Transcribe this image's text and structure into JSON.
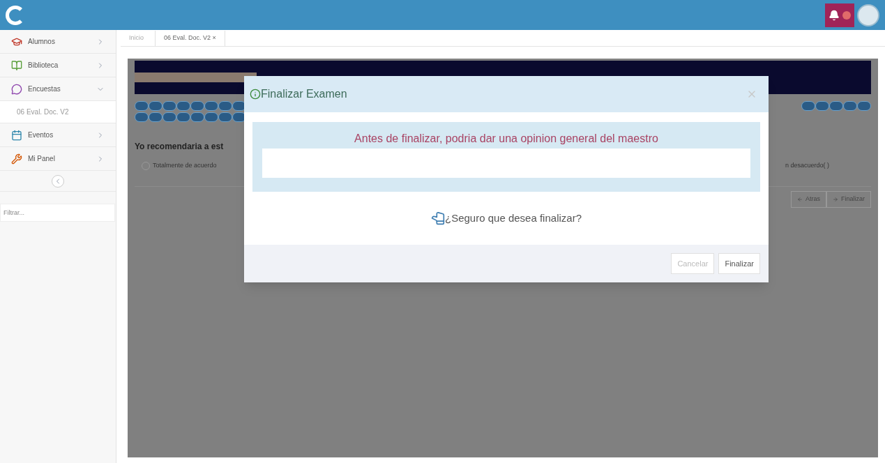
{
  "sidebar": {
    "items": [
      {
        "label": "Alumnos",
        "expanded": false
      },
      {
        "label": "Biblioteca",
        "expanded": false
      },
      {
        "label": "Encuestas",
        "expanded": true,
        "children": [
          {
            "label": "06 Eval. Doc. V2"
          }
        ]
      },
      {
        "label": "Eventos",
        "expanded": false
      },
      {
        "label": "Mi Panel",
        "expanded": false
      }
    ],
    "filter": {
      "placeholder": "Filtrar..."
    }
  },
  "tabs": [
    {
      "label": "Inicio",
      "selected": false
    },
    {
      "label": "06 Eval. Doc. V2 ×",
      "selected": true
    }
  ],
  "survey": {
    "question": "Yo recomendaria a est",
    "option_left": "Totalmente de acuerdo",
    "option_left_selected": false,
    "option_right": "n desacuerdo( )",
    "back": "Atras",
    "finish": "Finalizar"
  },
  "dialog": {
    "title": "Finalizar Examen",
    "prompt": "Antes de finalizar, podria dar una opinion general del maestro",
    "confirm": "¿Seguro que desea finalizar?",
    "buttons": [
      {
        "label": "Cancelar",
        "disabled": true
      },
      {
        "label": "Finalizar",
        "disabled": false
      }
    ]
  }
}
